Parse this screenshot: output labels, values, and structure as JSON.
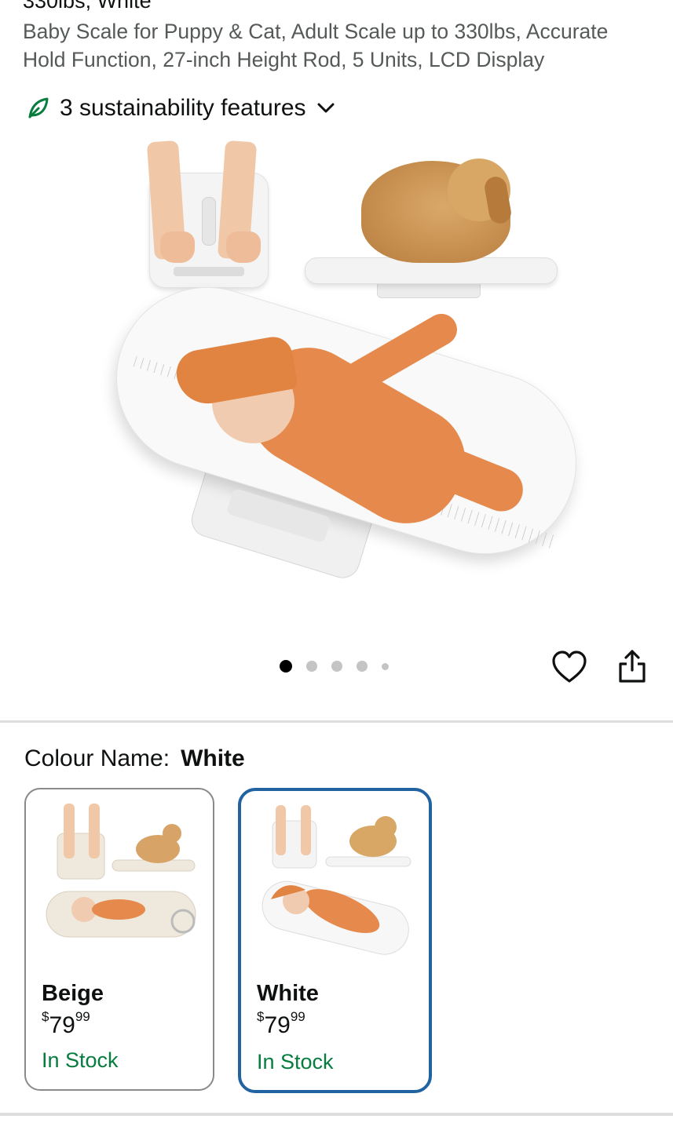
{
  "product": {
    "title_top_cut": "330lbs, White",
    "title": "Baby Scale for Puppy & Cat, Adult Scale up to 330lbs, Accurate Hold Function, 27-inch Height Rod, 5 Units, LCD Display"
  },
  "sustainability": {
    "label": "3 sustainability features",
    "icon": "leaf-icon",
    "color": "#067d3e"
  },
  "gallery": {
    "dot_count": 5,
    "active_index": 0
  },
  "actions": {
    "wishlist_icon": "heart-icon",
    "share_icon": "share-icon"
  },
  "colour": {
    "label": "Colour Name:",
    "selected": "White",
    "options": [
      {
        "name": "Beige",
        "price_symbol": "$",
        "price_whole": "79",
        "price_fraction": "99",
        "stock": "In Stock"
      },
      {
        "name": "White",
        "price_symbol": "$",
        "price_whole": "79",
        "price_fraction": "99",
        "stock": "In Stock"
      }
    ]
  },
  "colors": {
    "selected_border": "#2162a1",
    "in_stock": "#067d3e",
    "text": "#0f1111",
    "muted": "#565959"
  }
}
